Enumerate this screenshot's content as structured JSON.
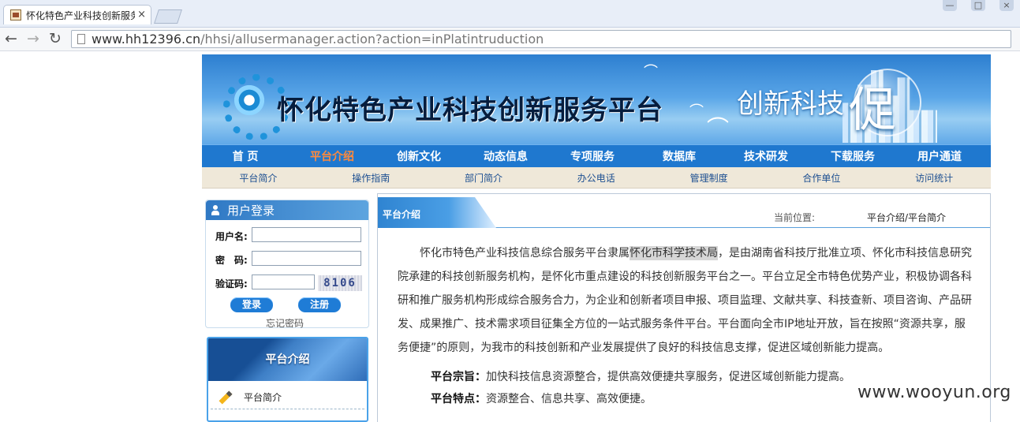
{
  "browser": {
    "tab_title": "怀化特色产业科技创新服务",
    "url_host": "www.hh12396.cn",
    "url_path": "/hhsi/allusermanager.action?action=inPlatintruduction"
  },
  "banner": {
    "title": "怀化特色产业科技创新服务平台",
    "slogan": "创新科技",
    "slogan_big": "促"
  },
  "main_nav": [
    "首 页",
    "平台介绍",
    "创新文化",
    "动态信息",
    "专项服务",
    "数据库",
    "技术研发",
    "下载服务",
    "用户通道"
  ],
  "sub_nav": [
    "平台简介",
    "操作指南",
    "部门简介",
    "办公电话",
    "管理制度",
    "合作单位",
    "访问统计"
  ],
  "login": {
    "title": "用户登录",
    "username_label": "用户名:",
    "password_label": "密　码:",
    "captcha_label": "验证码:",
    "captcha_text": "8106",
    "login_button": "登录",
    "register_button": "注册",
    "forgot_password": "忘记密码"
  },
  "sidebar": {
    "title": "平台介绍",
    "items": [
      "平台简介"
    ]
  },
  "content": {
    "section_title": "平台介绍",
    "breadcrumb_label": "当前位置:",
    "breadcrumb": "平台介绍/平台简介",
    "paragraph_before": "怀化市特色产业科技信息综合服务平台隶属",
    "paragraph_highlight": "怀化市科学技术局",
    "paragraph_after": "，是由湖南省科技厅批准立项、怀化市科技信息研究院承建的科技创新服务机构，是怀化市重点建设的科技创新服务平台之一。平台立足全市特色优势产业，积极协调各科研和推广服务机构形成综合服务合力，为企业和创新者项目申报、项目监理、文献共享、科技查新、项目咨询、产品研发、成果推广、技术需求项目征集全方位的一站式服务条件平台。平台面向全市IP地址开放，旨在按照“资源共享，服务便捷”的原则，为我市的科技创新和产业发展提供了良好的科技信息支撑，促进区域创新能力提高。",
    "purpose_label": "平台宗旨：",
    "purpose_text": "加快科技信息资源整合，提供高效便捷共享服务，促进区域创新能力提高。",
    "features_label": "平台特点：",
    "features_text": "资源整合、信息共享、高效便捷。"
  },
  "watermark": "www.wooyun.org",
  "colors": {
    "nav_blue": "#1f78cf",
    "active_nav": "#ff8a3d",
    "subnav_bg": "#efe8d9"
  }
}
